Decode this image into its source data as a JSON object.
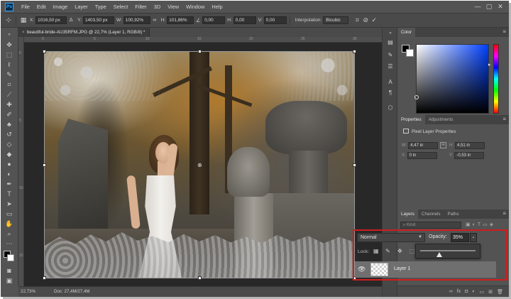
{
  "app": {
    "logo": "Ps"
  },
  "menu": [
    "File",
    "Edit",
    "Image",
    "Layer",
    "Type",
    "Select",
    "Filter",
    "3D",
    "View",
    "Window",
    "Help"
  ],
  "window_controls": {
    "minimize": "—",
    "maximize": "▢",
    "close": "✕"
  },
  "options_bar": {
    "x_label": "X:",
    "x_value": "1016,50 px",
    "y_label": "Y:",
    "y_value": "1403,50 px",
    "w_label": "W:",
    "w_value": "100,92%",
    "h_label": "H:",
    "h_value": "101,86%",
    "angle_value": "0,00",
    "hskew_label": "H:",
    "hskew_value": "0,00",
    "vskew_label": "V:",
    "vskew_value": "0,00",
    "interpolation_label": "Interpolation:",
    "interpolation_value": "Bicubic"
  },
  "document": {
    "tab_title": "beautiful-bride-AU35RFM.JPG @ 22,7% (Layer 1, RGB/8) *",
    "ruler_top": [
      "0",
      "5",
      "10",
      "15",
      "20",
      "25",
      "30"
    ],
    "ruler_left": [
      "0",
      "5",
      "10",
      "15"
    ]
  },
  "status": {
    "zoom": "22,73%",
    "doc_size": "Doc: 27,4M/27,4M"
  },
  "panels": {
    "color_tab": "Color",
    "properties_tab": "Properties",
    "adjustments_tab": "Adjustments",
    "properties_title": "Pixel Layer Properties",
    "w_label": "W:",
    "w_value": "4,47 in",
    "h_label": "H:",
    "h_value": "4,51 in",
    "x_label": "X:",
    "x_value": "0 in",
    "y_label": "Y:",
    "y_value": "-0,53 in",
    "layers_tab": "Layers",
    "channels_tab": "Channels",
    "paths_tab": "Paths",
    "kind_placeholder": "Kind"
  },
  "layers": {
    "blend_mode": "Normal",
    "opacity_label": "Opacity:",
    "opacity_value": "35%",
    "opacity_fraction": 0.35,
    "lock_label": "Lock:",
    "layer_name": "Layer 1"
  },
  "colors": {
    "highlight": "#d01c1c",
    "foreground": "#000000",
    "background": "#ffffff"
  }
}
